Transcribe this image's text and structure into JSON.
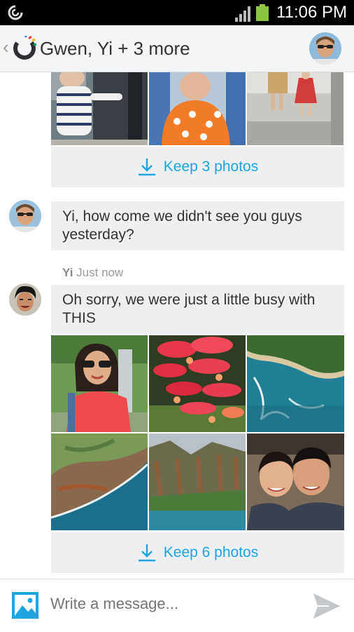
{
  "status_bar": {
    "time": "11:06 PM"
  },
  "header": {
    "back_glyph": "‹",
    "title": "Gwen, Yi + 3 more"
  },
  "conversation": {
    "top_keep_label": "Keep 3 photos",
    "message_gwen": "Yi, how come we didn't see you guys yesterday?",
    "yi_meta": {
      "sender": "Yi",
      "time": "Just now"
    },
    "message_yi": "Oh sorry, we were just a little busy with THIS",
    "bottom_keep_label": "Keep 6 photos"
  },
  "composer": {
    "placeholder": "Write a message..."
  },
  "colors": {
    "accent": "#1ea5df",
    "bubble": "#eeeff0",
    "header": "#f4f5f6"
  },
  "icons": [
    "sync-icon",
    "signal-icon",
    "battery-icon",
    "app-logo-icon",
    "download-icon",
    "image-icon",
    "send-icon"
  ]
}
